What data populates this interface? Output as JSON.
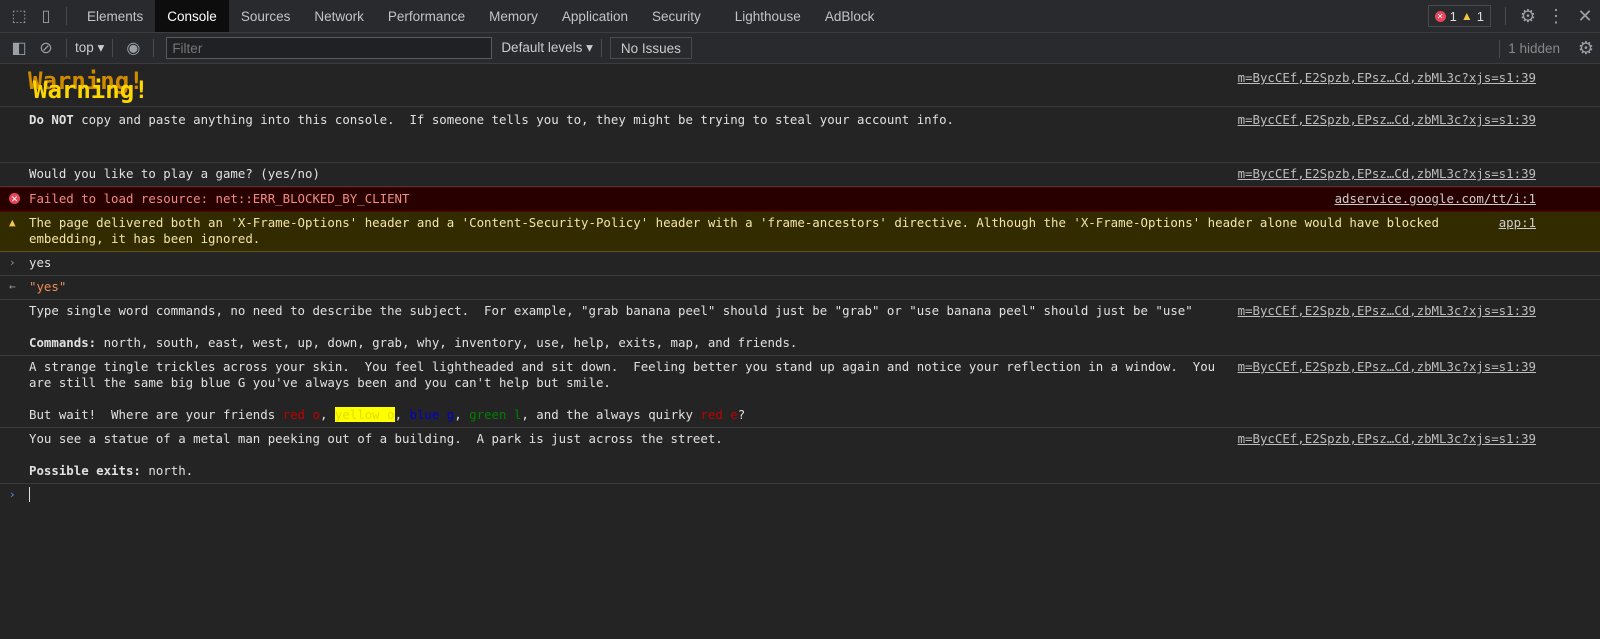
{
  "tabs": [
    "Elements",
    "Console",
    "Sources",
    "Network",
    "Performance",
    "Memory",
    "Application",
    "Security",
    "Lighthouse",
    "AdBlock"
  ],
  "active_tab": "Console",
  "badges": {
    "errors": "1",
    "warnings": "1"
  },
  "toolbar": {
    "context": "top",
    "filter_placeholder": "Filter",
    "levels": "Default levels",
    "issues": "No Issues",
    "hidden": "1 hidden"
  },
  "src_main": "m=BycCEf,E2Spzb,EPsz…Cd,zbML3c?xjs=s1:39",
  "messages": {
    "warning_title": "Warning!",
    "do_not_bold": "Do NOT",
    "do_not_rest": " copy and paste anything into this console.  If someone tells you to, they might be trying to steal your account info.",
    "play": "Would you like to play a game? (yes/no)",
    "error": "Failed to load resource: net::ERR_BLOCKED_BY_CLIENT",
    "error_src": "adservice.google.com/tt/i:1",
    "warn": "The page delivered both an 'X-Frame-Options' header and a 'Content-Security-Policy' header with a 'frame-ancestors' directive. Although the 'X-Frame-Options' header alone would have blocked embedding, it has been ignored.",
    "warn_src": "app:1",
    "input": "yes",
    "result": "\"yes\"",
    "type_cmds": "Type single word commands, no need to describe the subject.  For example, \"grab banana peel\" should just be \"grab\" or \"use banana peel\" should just be \"use\"",
    "commands_label": "Commands:",
    "commands": " north, south, east, west, up, down, grab, why, inventory, use, help, exits, map, and friends.",
    "strange": "A strange tingle trickles across your skin.  You feel lightheaded and sit down.  Feeling better you stand up again and notice your reflection in a window.  You are still the same big blue G you've always been and you can't help but smile.",
    "wait_pre": "But wait!  Where are your friends ",
    "friend1": "red o",
    "friend2": "yellow o",
    "friend3": "blue g",
    "friend4": "green l",
    "wait_mid": ", and the always quirky ",
    "friend5": "red e",
    "statue": "You see a statue of a metal man peeking out of a building.  A park is just across the street.",
    "exits_label": "Possible exits:",
    "exits": " north."
  },
  "colors": {
    "red": "#c00000",
    "yellow_bg": "#ffff00",
    "blue": "#0000cc",
    "green": "#008000"
  }
}
